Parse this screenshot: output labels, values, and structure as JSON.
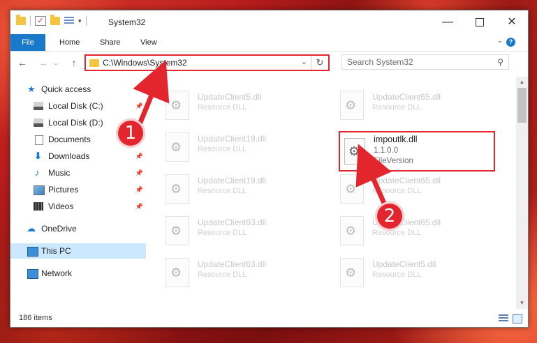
{
  "window": {
    "title": "System32",
    "controls": {
      "minimize": "—",
      "maximize": "☐",
      "close": "✕"
    }
  },
  "quick_access_toolbar": {
    "dropdown": "▾"
  },
  "ribbon": {
    "tabs": [
      {
        "label": "File"
      },
      {
        "label": "Home"
      },
      {
        "label": "Share"
      },
      {
        "label": "View"
      }
    ],
    "help": "?",
    "collapse": "⌄"
  },
  "navigation": {
    "back": "←",
    "forward": "→",
    "recent": "⌄",
    "up": "↑",
    "address": "C:\\Windows\\System32",
    "address_dropdown": "⌄",
    "refresh": "↻",
    "search_placeholder": "Search System32",
    "search_icon": "⚲"
  },
  "sidebar": {
    "items": [
      {
        "label": "Quick access",
        "icon": "star-icon",
        "pinned": false
      },
      {
        "label": "Local Disk (C:)",
        "icon": "disk-icon",
        "pinned": true
      },
      {
        "label": "Local Disk (D:)",
        "icon": "disk-icon",
        "pinned": true
      },
      {
        "label": "Documents",
        "icon": "document-icon",
        "pinned": true
      },
      {
        "label": "Downloads",
        "icon": "download-icon",
        "pinned": true
      },
      {
        "label": "Music",
        "icon": "music-icon",
        "pinned": true
      },
      {
        "label": "Pictures",
        "icon": "pictures-icon",
        "pinned": true
      },
      {
        "label": "Videos",
        "icon": "videos-icon",
        "pinned": true
      },
      {
        "label": "OneDrive",
        "icon": "onedrive-icon",
        "pinned": false
      },
      {
        "label": "This PC",
        "icon": "pc-icon",
        "pinned": false,
        "selected": true
      },
      {
        "label": "Network",
        "icon": "network-icon",
        "pinned": false
      }
    ],
    "pin_glyph": "📌"
  },
  "files": [
    {
      "name": "UpdateClient5.dll",
      "type": "Resource DLL"
    },
    {
      "name": "UpdateClient65.dll",
      "type": "Resource DLL"
    },
    {
      "name": "UpdateClient19.dll",
      "type": "Resource DLL"
    },
    {
      "name": "UpdateClient19.dll",
      "type": "Resource DLL"
    },
    {
      "name": "UpdateClient65.dll",
      "type": "Resource DLL"
    },
    {
      "name": "UpdateClient63.dll",
      "type": "Resource DLL"
    },
    {
      "name": "UpdateClient65.dll",
      "type": "Resource DLL"
    },
    {
      "name": "UpdateClient63.dll",
      "type": "Resource DLL"
    },
    {
      "name": "UpdateClient5.dll",
      "type": "Resource DLL"
    }
  ],
  "highlighted_file": {
    "name": "impoutlk.dll",
    "version": "1.1.0.0",
    "description": "FileVersion"
  },
  "status": {
    "item_count": "186 items"
  },
  "annotations": {
    "step1": "1",
    "step2": "2",
    "color": "#e3262e"
  },
  "scrollbar": {
    "up": "▲",
    "down": "▼"
  }
}
